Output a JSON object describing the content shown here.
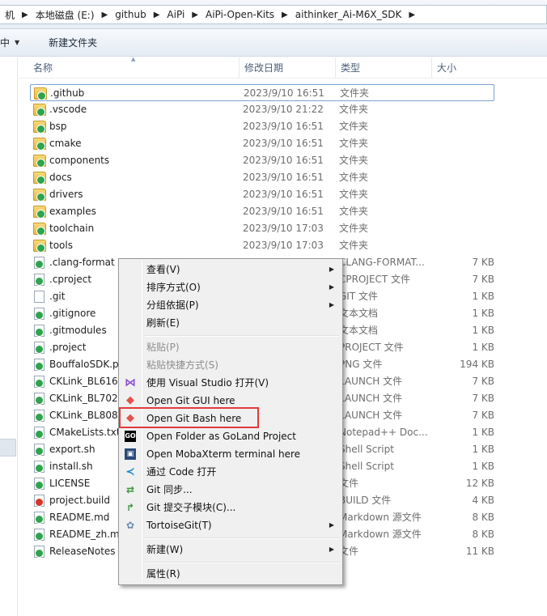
{
  "address": {
    "crumbs": [
      "机",
      "本地磁盘 (E:)",
      "github",
      "AiPi",
      "AiPi-Open-Kits",
      "aithinker_Ai-M6X_SDK"
    ]
  },
  "toolbar": {
    "partial_label": "中",
    "new_folder": "新建文件夹"
  },
  "columns": {
    "name": "名称",
    "date": "修改日期",
    "type": "类型",
    "size": "大小"
  },
  "files": [
    {
      "name": ".github",
      "date": "2023/9/10 16:51",
      "type": "文件夹",
      "size": "",
      "icon": "folder-git-icon"
    },
    {
      "name": ".vscode",
      "date": "2023/9/10 21:22",
      "type": "文件夹",
      "size": "",
      "icon": "folder-git-icon"
    },
    {
      "name": "bsp",
      "date": "2023/9/10 16:51",
      "type": "文件夹",
      "size": "",
      "icon": "folder-git-icon"
    },
    {
      "name": "cmake",
      "date": "2023/9/10 16:51",
      "type": "文件夹",
      "size": "",
      "icon": "folder-git-icon"
    },
    {
      "name": "components",
      "date": "2023/9/10 16:51",
      "type": "文件夹",
      "size": "",
      "icon": "folder-git-icon"
    },
    {
      "name": "docs",
      "date": "2023/9/10 16:51",
      "type": "文件夹",
      "size": "",
      "icon": "folder-git-icon"
    },
    {
      "name": "drivers",
      "date": "2023/9/10 16:51",
      "type": "文件夹",
      "size": "",
      "icon": "folder-git-icon"
    },
    {
      "name": "examples",
      "date": "2023/9/10 16:51",
      "type": "文件夹",
      "size": "",
      "icon": "folder-git-icon"
    },
    {
      "name": "toolchain",
      "date": "2023/9/10 17:03",
      "type": "文件夹",
      "size": "",
      "icon": "folder-git-icon"
    },
    {
      "name": "tools",
      "date": "2023/9/10 17:03",
      "type": "文件夹",
      "size": "",
      "icon": "folder-git-icon"
    },
    {
      "name": ".clang-format",
      "date": "",
      "type": "CLANG-FORMAT...",
      "size": "7 KB",
      "icon": "file-git-icon"
    },
    {
      "name": ".cproject",
      "date": "",
      "type": "CPROJECT 文件",
      "size": "7 KB",
      "icon": "file-git-icon"
    },
    {
      "name": ".git",
      "date": "",
      "type": "GIT 文件",
      "size": "1 KB",
      "icon": "file-icon"
    },
    {
      "name": ".gitignore",
      "date": "",
      "type": "文本文档",
      "size": "1 KB",
      "icon": "file-git-icon"
    },
    {
      "name": ".gitmodules",
      "date": "",
      "type": "文本文档",
      "size": "1 KB",
      "icon": "file-git-icon"
    },
    {
      "name": ".project",
      "date": "",
      "type": "PROJECT 文件",
      "size": "1 KB",
      "icon": "file-git-icon"
    },
    {
      "name": "BouffaloSDK.p",
      "date": "",
      "type": "PNG 文件",
      "size": "194 KB",
      "icon": "file-git-icon"
    },
    {
      "name": "CKLink_BL616.l",
      "date": "",
      "type": "LAUNCH 文件",
      "size": "7 KB",
      "icon": "file-git-icon"
    },
    {
      "name": "CKLink_BL702.l",
      "date": "",
      "type": "LAUNCH 文件",
      "size": "7 KB",
      "icon": "file-git-icon"
    },
    {
      "name": "CKLink_BL808.l",
      "date": "",
      "type": "LAUNCH 文件",
      "size": "7 KB",
      "icon": "file-git-icon"
    },
    {
      "name": "CMakeLists.txt",
      "date": "",
      "type": "Notepad++ Doc...",
      "size": "1 KB",
      "icon": "file-git-icon"
    },
    {
      "name": "export.sh",
      "date": "",
      "type": "Shell Script",
      "size": "1 KB",
      "icon": "file-git-icon"
    },
    {
      "name": "install.sh",
      "date": "",
      "type": "Shell Script",
      "size": "1 KB",
      "icon": "file-git-icon"
    },
    {
      "name": "LICENSE",
      "date": "",
      "type": "文件",
      "size": "12 KB",
      "icon": "file-git-icon"
    },
    {
      "name": "project.build",
      "date": "",
      "type": "BUILD 文件",
      "size": "4 KB",
      "icon": "file-red-icon"
    },
    {
      "name": "README.md",
      "date": "",
      "type": "Markdown 源文件",
      "size": "8 KB",
      "icon": "file-git-icon"
    },
    {
      "name": "README_zh.md",
      "date": "",
      "type": "Markdown 源文件",
      "size": "8 KB",
      "icon": "file-git-icon"
    },
    {
      "name": "ReleaseNotes",
      "date": "",
      "type": "文件",
      "size": "11 KB",
      "icon": "file-git-icon"
    }
  ],
  "context_menu": {
    "view": "查看(V)",
    "sort": "排序方式(O)",
    "group": "分组依据(P)",
    "refresh": "刷新(E)",
    "paste": "粘贴(P)",
    "paste_shortcut": "粘贴快捷方式(S)",
    "open_vs": "使用 Visual Studio 打开(V)",
    "git_gui": "Open Git GUI here",
    "git_bash": "Open Git Bash here",
    "goland": "Open Folder as GoLand Project",
    "mobaxterm": "Open MobaXterm terminal here",
    "vscode": "通过 Code 打开",
    "git_sync": "Git 同步...",
    "git_submodule": "Git 提交子模块(C)...",
    "tortoisegit": "TortoiseGit(T)",
    "new": "新建(W)",
    "properties": "属性(R)"
  },
  "colors": {
    "highlight_box": "#e23a3a",
    "selection_border": "#7da2ce"
  }
}
